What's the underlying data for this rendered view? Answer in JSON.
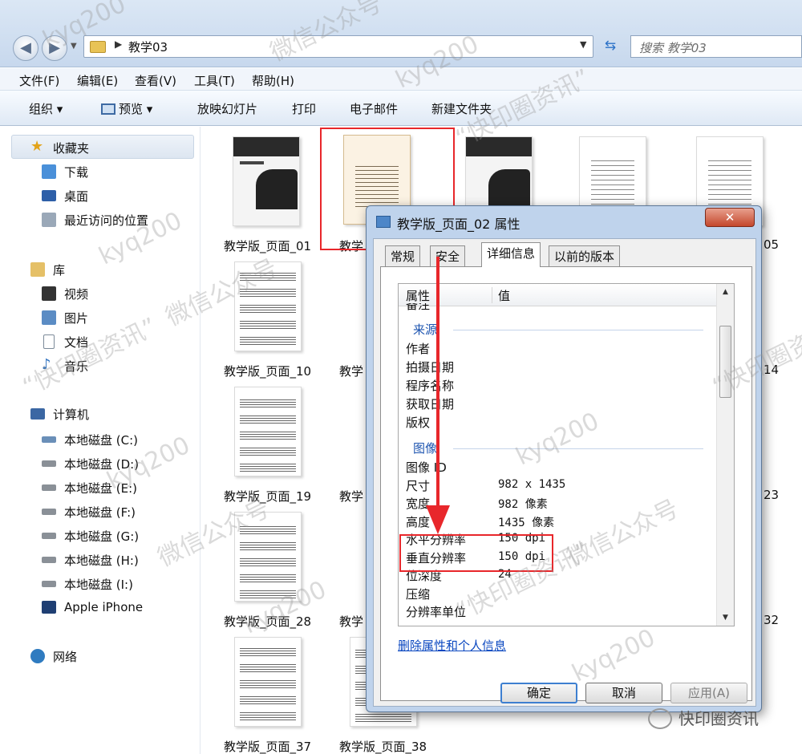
{
  "address": {
    "path": "教学03",
    "search_placeholder": "搜索 教学03"
  },
  "menu": [
    "文件(F)",
    "编辑(E)",
    "查看(V)",
    "工具(T)",
    "帮助(H)"
  ],
  "toolbar": {
    "organize": "组织",
    "preview": "预览",
    "slideshow": "放映幻灯片",
    "print": "打印",
    "email": "电子邮件",
    "new_folder": "新建文件夹"
  },
  "sidebar": {
    "favorites": "收藏夹",
    "downloads": "下载",
    "desktop": "桌面",
    "recent": "最近访问的位置",
    "library": "库",
    "videos": "视频",
    "pictures": "图片",
    "documents": "文档",
    "music": "音乐",
    "computer": "计算机",
    "drives": [
      "本地磁盘 (C:)",
      "本地磁盘 (D:)",
      "本地磁盘 (E:)",
      "本地磁盘 (F:)",
      "本地磁盘 (G:)",
      "本地磁盘 (H:)",
      "本地磁盘 (I:)"
    ],
    "iphone": "Apple iPhone",
    "network": "网络"
  },
  "files": {
    "p01": "教学版_页面_01",
    "p10": "教学版_页面_10",
    "p19": "教学版_页面_19",
    "p28": "教学版_页面_28",
    "p37": "教学版_页面_37",
    "p38": "教学版_页面_38",
    "c2_prefix": "教学",
    "right_05": "05",
    "right_14": "14",
    "right_23": "23",
    "right_32": "32"
  },
  "dialog": {
    "title": "教学版_页面_02 属性",
    "close": "✕",
    "tabs": [
      "常规",
      "安全",
      "详细信息",
      "以前的版本"
    ],
    "col_property": "属性",
    "col_value": "值",
    "row_partial": "备注",
    "group_source": "来源",
    "source_rows": [
      "作者",
      "拍摄日期",
      "程序名称",
      "获取日期",
      "版权"
    ],
    "group_image": "图像",
    "image_rows": [
      {
        "k": "图像 ID",
        "v": ""
      },
      {
        "k": "尺寸",
        "v": "982 x 1435"
      },
      {
        "k": "宽度",
        "v": "982 像素"
      },
      {
        "k": "高度",
        "v": "1435 像素"
      },
      {
        "k": "水平分辨率",
        "v": "150 dpi"
      },
      {
        "k": "垂直分辨率",
        "v": "150 dpi"
      },
      {
        "k": "位深度",
        "v": "24"
      },
      {
        "k": "压缩",
        "v": ""
      },
      {
        "k": "分辨率单位",
        "v": ""
      }
    ],
    "remove_link": "删除属性和个人信息",
    "ok": "确定",
    "cancel": "取消",
    "apply": "应用(A)"
  },
  "watermarks": [
    "kyq200",
    "微信公众号",
    "“快印圈资讯”"
  ],
  "brand": "快印圈资讯",
  "colors": {
    "annotation_red": "#e8272b",
    "link_blue": "#0a47c0",
    "group_blue": "#1e55b0"
  }
}
